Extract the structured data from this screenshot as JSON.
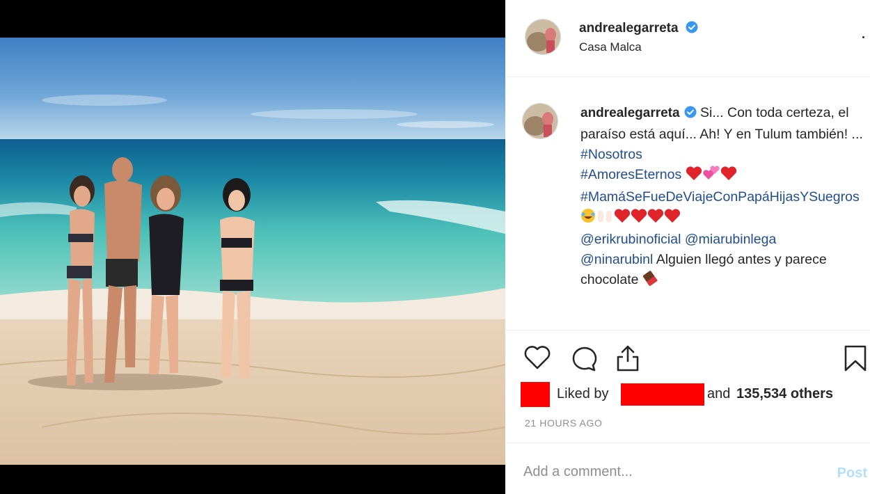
{
  "post": {
    "username": "andrealegarreta",
    "location": "Casa Malca",
    "caption": {
      "username": "andrealegarreta",
      "line1_text": " Si... Con toda certeza, el paraíso está aquí... Ah! Y en Tulum también! ... ",
      "tag1": "#Nosotros",
      "tag2": "#AmoresEternos",
      "tag3": "#MamáSeFueDeViajeConPapáHijasYSuegros",
      "mention1": "@erikrubinoficial",
      "mention2": "@miarubinlega",
      "mention3": "@ninarubinl",
      "closing_text": " Alguien llegó antes y parece chocolate"
    },
    "likes": {
      "prefix": "Liked by",
      "connector": "and",
      "count": "135,534",
      "suffix": "others"
    },
    "timestamp": "21 HOURS AGO",
    "comment": {
      "placeholder": "Add a comment...",
      "post_label": "Post"
    }
  },
  "icons": [
    "verified-icon",
    "heart-icon",
    "comment-icon",
    "share-icon",
    "bookmark-icon",
    "chocolate-emoji",
    "heart-emoji",
    "two-hearts-emoji",
    "laughing-emoji",
    "raised-hands-emoji"
  ],
  "colors": {
    "link": "#1f4d8f",
    "verified": "#3897f0",
    "redaction": "#ff0000",
    "post_button": "#b2dffc",
    "muted": "#8e8e8e"
  }
}
